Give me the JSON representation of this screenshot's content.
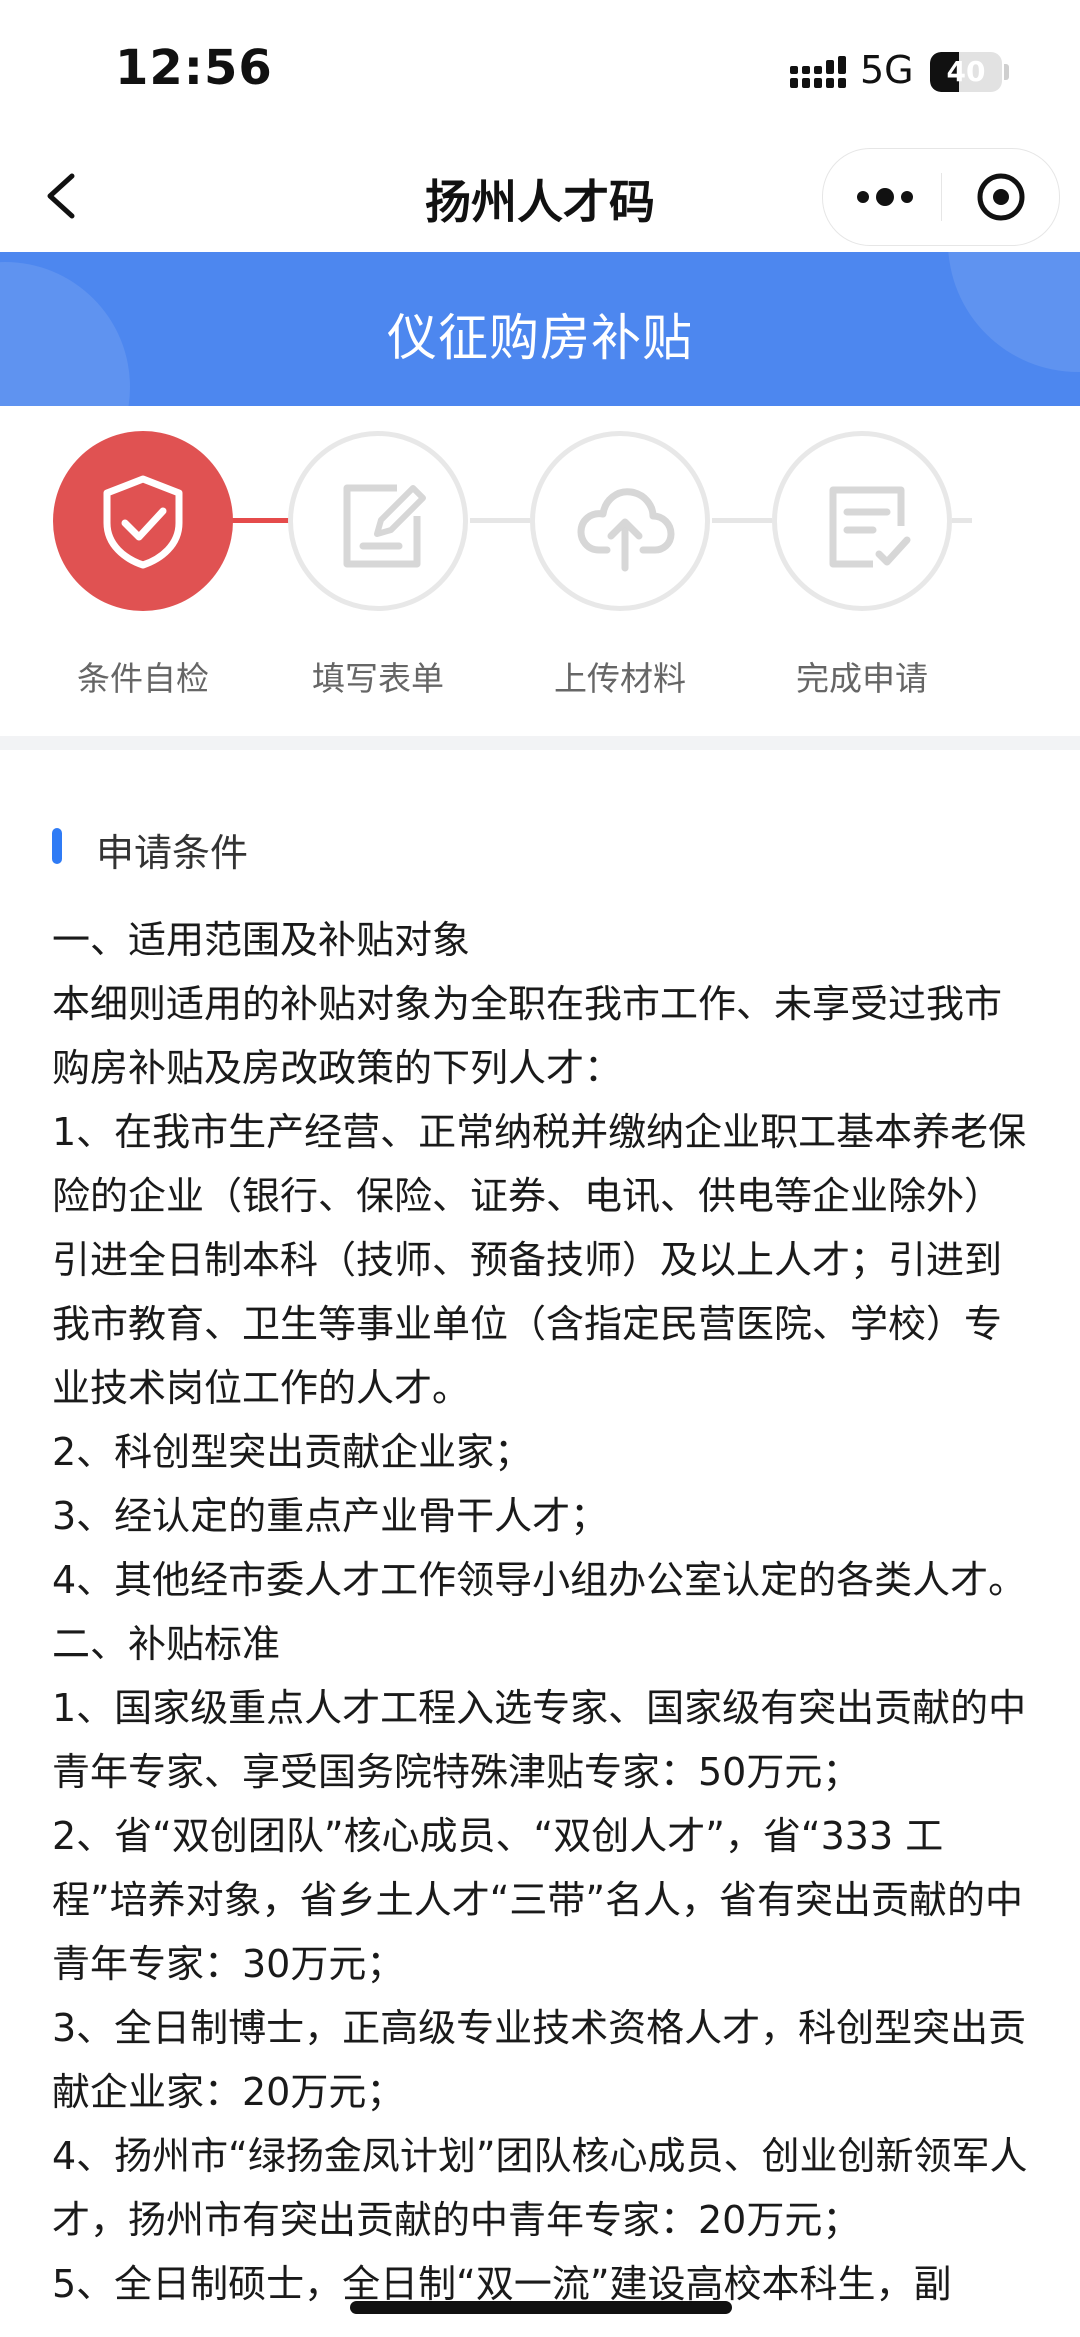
{
  "status_bar": {
    "time": "12:56",
    "network": "5G",
    "battery": "40",
    "battery_level": 0.4
  },
  "nav": {
    "title": "扬州人才码"
  },
  "banner": {
    "title": "仪征购房补贴"
  },
  "steps": [
    {
      "label": "条件自检",
      "icon": "shield-check-icon",
      "active": true
    },
    {
      "label": "填写表单",
      "icon": "edit-form-icon",
      "active": false
    },
    {
      "label": "上传材料",
      "icon": "cloud-upload-icon",
      "active": false
    },
    {
      "label": "完成申请",
      "icon": "document-check-icon",
      "active": false
    }
  ],
  "colors": {
    "accent": "#4d87ef",
    "active_step": "#e05252",
    "header_bar": "#2f7bf5"
  },
  "content": {
    "header": "申请条件",
    "paragraphs": [
      "一、适用范围及补贴对象",
      "本细则适用的补贴对象为全职在我市工作、未享受过我市购房补贴及房改政策的下列人才：",
      "1、在我市生产经营、正常纳税并缴纳企业职工基本养老保险的企业（银行、保险、证券、电讯、供电等企业除外）引进全日制本科（技师、预备技师）及以上人才；引进到我市教育、卫生等事业单位（含指定民营医院、学校）专业技术岗位工作的人才。",
      "2、科创型突出贡献企业家；",
      "3、经认定的重点产业骨干人才；",
      "4、其他经市委人才工作领导小组办公室认定的各类人才。",
      "二、补贴标准",
      "1、国家级重点人才工程入选专家、国家级有突出贡献的中青年专家、享受国务院特殊津贴专家：50万元；",
      "2、省“双创团队”核心成员、“双创人才”，省“333 工程”培养对象，省乡土人才“三带”名人，省有突出贡献的中青年专家：30万元；",
      "3、全日制博士，正高级专业技术资格人才，科创型突出贡献企业家：20万元；",
      "4、扬州市“绿扬金凤计划”团队核心成员、创业创新领军人才，扬州市有突出贡献的中青年专家：20万元；",
      "5、全日制硕士，全日制“双一流”建设高校本科生，副"
    ]
  }
}
